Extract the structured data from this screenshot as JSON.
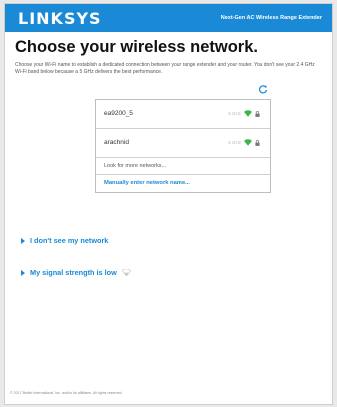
{
  "header": {
    "logo": "LINKSYS",
    "product": "Next-Gen AC Wireless Range Extender"
  },
  "page": {
    "title": "Choose your wireless network.",
    "description": "Choose your Wi-Fi name to establish a dedicated connection between your range extender and your router. You don't see your 2.4 GHz Wi-Fi band below because a 5 GHz delivers the best performance."
  },
  "networks": [
    {
      "name": "ea9200_5",
      "band": "5 GHz",
      "icon": "wifi-icon",
      "secured": true
    },
    {
      "name": "arachnid",
      "band": "5 GHz",
      "icon": "wifi-icon",
      "secured": true
    }
  ],
  "more_networks_label": "Look for more networks...",
  "manual_entry_label": "Manually enter network name...",
  "links": {
    "dont_see": "I don't see my network",
    "signal_low": "My signal strength is low"
  },
  "footer": "© 2017 Belkin International, Inc. and/or its affiliates. All rights reserved.",
  "colors": {
    "brand": "#1a8ad6",
    "signal": "#3cb54a"
  }
}
